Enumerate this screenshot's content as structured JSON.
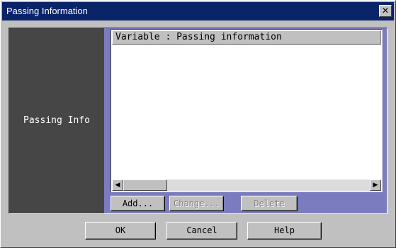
{
  "window": {
    "title": "Passing Information",
    "close_glyph": "✕"
  },
  "side": {
    "label": "Passing Info"
  },
  "list": {
    "header": "Variable : Passing information",
    "rows": []
  },
  "scrollbar": {
    "left_glyph": "◀",
    "right_glyph": "▶"
  },
  "list_buttons": {
    "add": "Add...",
    "change": "Change...",
    "delete": "Delete"
  },
  "dialog_buttons": {
    "ok": "OK",
    "cancel": "Cancel",
    "help": "Help"
  },
  "colors": {
    "titlebar": "#0a246a",
    "panel": "#7b7bbf",
    "side": "#464646",
    "dialog": "#c0c0c0"
  }
}
